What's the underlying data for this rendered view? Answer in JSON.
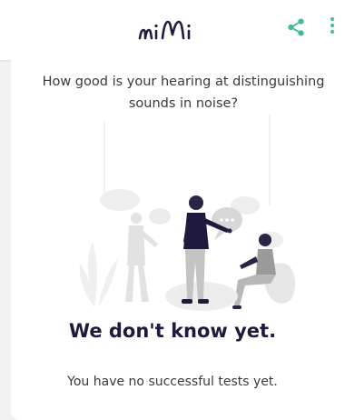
{
  "header": {
    "logo_text": "mimi",
    "share_icon": "share-icon",
    "more_icon": "more-vertical-icon",
    "accent_color": "#3dbf8f"
  },
  "card": {
    "question": "How good is your hearing at distinguishing sounds in noise?",
    "illustration": "people-conversation-illustration",
    "headline": "We don't know yet.",
    "subtext": "You have no successful tests yet."
  }
}
